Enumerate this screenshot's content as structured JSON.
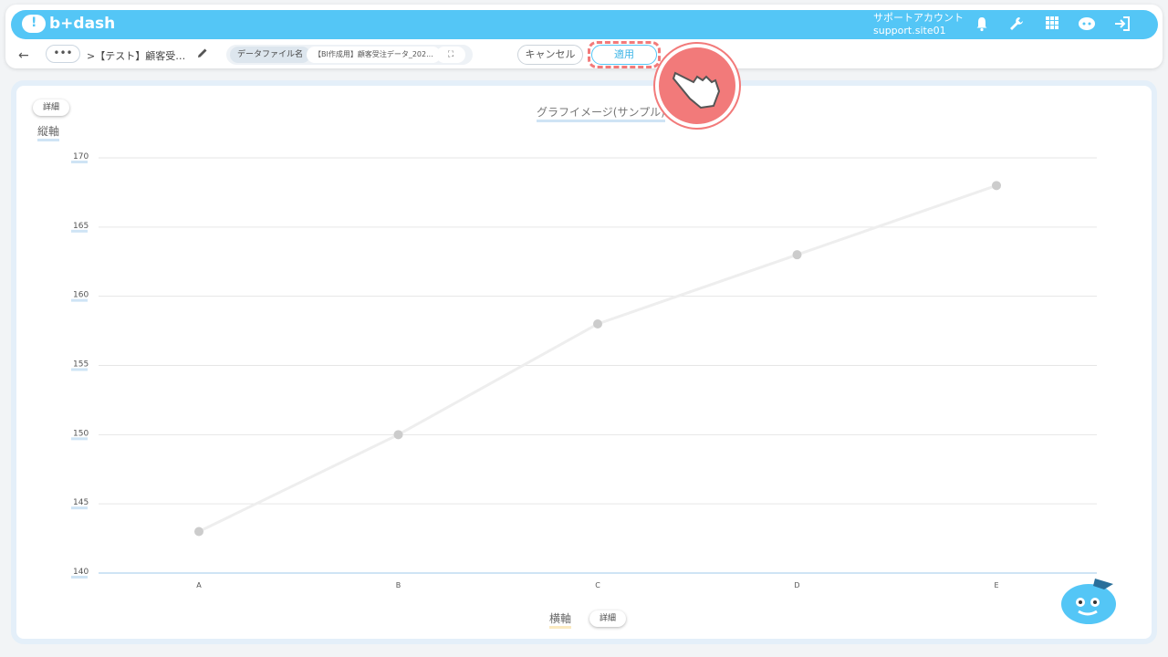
{
  "header": {
    "logo_text": "b+dash",
    "account_line1": "サポートアカウント",
    "account_line2": "support.site01",
    "icons": [
      "bell-icon",
      "wrench-icon",
      "grid-icon",
      "ai-bot-icon",
      "logout-icon"
    ]
  },
  "toolbar": {
    "back_label": "←",
    "more_label": "•••",
    "breadcrumb": ">【テスト】顧客受…",
    "file_label": "データファイル名",
    "file_name": "【BI作成用】顧客受注データ_202...",
    "expand_label": "⛶",
    "cancel_label": "キャンセル",
    "apply_label": "適用"
  },
  "panel": {
    "y_detail_label": "詳細",
    "y_axis_title": "縦軸",
    "x_axis_title": "横軸",
    "x_detail_label": "詳細",
    "chart_title": "グラフイメージ(サンプル)"
  },
  "colors": {
    "brand": "#54c6f6",
    "highlight": "#f27a7a",
    "line": "#eeeeee",
    "point": "#cccccc"
  },
  "chart_data": {
    "type": "line",
    "title": "グラフイメージ(サンプル)",
    "xlabel": "横軸",
    "ylabel": "縦軸",
    "categories": [
      "A",
      "B",
      "C",
      "D",
      "E"
    ],
    "series": [
      {
        "values": [
          143,
          150,
          158,
          163,
          168
        ]
      }
    ],
    "ylim": [
      140,
      170
    ],
    "yticks": [
      140,
      145,
      150,
      155,
      160,
      165,
      170
    ],
    "grid": true
  }
}
